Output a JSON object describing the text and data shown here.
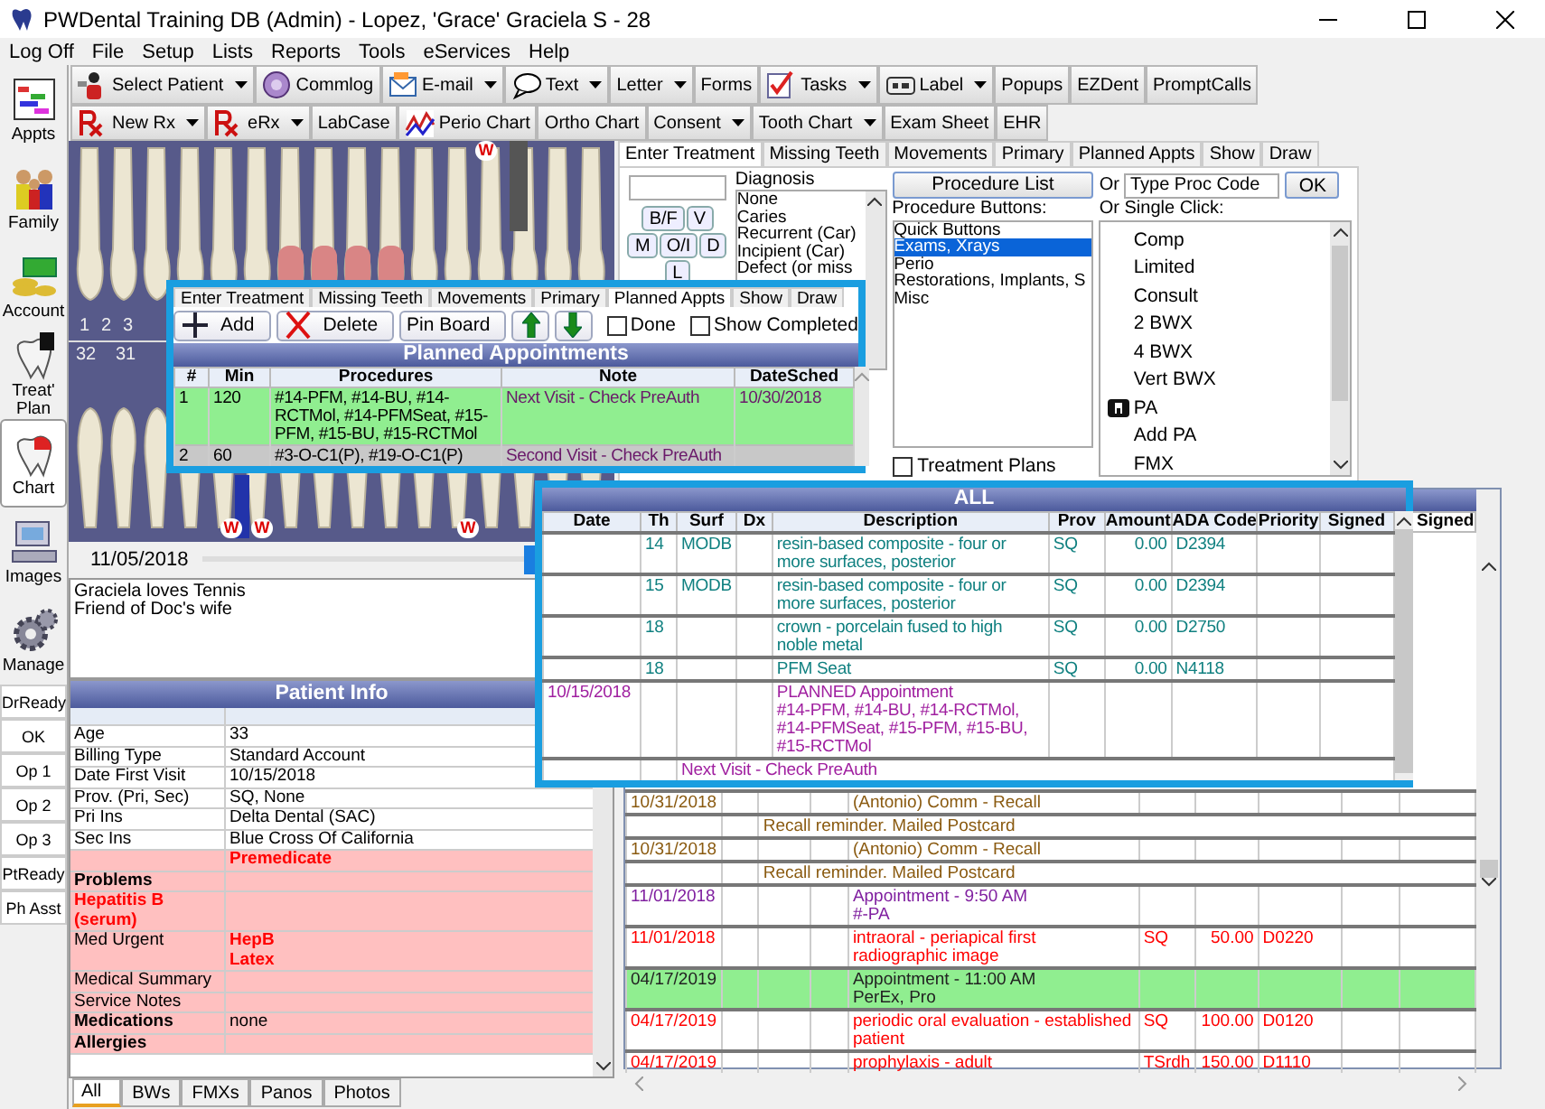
{
  "window": {
    "title": "PWDental Training DB (Admin) - Lopez, 'Grace' Graciela S - 28"
  },
  "menu": [
    "Log Off",
    "File",
    "Setup",
    "Lists",
    "Reports",
    "Tools",
    "eServices",
    "Help"
  ],
  "modules": [
    {
      "label": "Appts",
      "selected": false
    },
    {
      "label": "Family",
      "selected": false
    },
    {
      "label": "Account",
      "selected": false
    },
    {
      "label": "Treat' Plan",
      "selected": false
    },
    {
      "label": "Chart",
      "selected": true
    },
    {
      "label": "Images",
      "selected": false
    },
    {
      "label": "Manage",
      "selected": false
    }
  ],
  "status_buttons": [
    "DrReady",
    "OK",
    "Op 1",
    "Op 2",
    "Op 3",
    "PtReady",
    "Ph Asst"
  ],
  "toolbar_1": [
    {
      "label": "Select Patient",
      "dropdown": true
    },
    {
      "label": "Commlog",
      "dropdown": false
    },
    {
      "label": "E-mail",
      "dropdown": true
    },
    {
      "label": "Text",
      "dropdown": true
    },
    {
      "label": "Letter",
      "dropdown": true
    },
    {
      "label": "Forms",
      "dropdown": false
    },
    {
      "label": "Tasks",
      "dropdown": true
    },
    {
      "label": "Label",
      "dropdown": true
    },
    {
      "label": "Popups",
      "dropdown": false
    },
    {
      "label": "EZDent",
      "dropdown": false
    },
    {
      "label": "PromptCalls",
      "dropdown": false
    }
  ],
  "toolbar_2": [
    {
      "label": "New Rx",
      "dropdown": true
    },
    {
      "label": "eRx",
      "dropdown": true
    },
    {
      "label": "LabCase",
      "dropdown": false
    },
    {
      "label": "Perio Chart",
      "dropdown": false
    },
    {
      "label": "Ortho Chart",
      "dropdown": false
    },
    {
      "label": "Consent",
      "dropdown": true
    },
    {
      "label": "Tooth Chart",
      "dropdown": true
    },
    {
      "label": "Exam Sheet",
      "dropdown": false
    },
    {
      "label": "EHR",
      "dropdown": false
    }
  ],
  "tooth_chart": {
    "upper_numbers": [
      "1",
      "2",
      "3"
    ],
    "lower_numbers": [
      "32",
      "31"
    ],
    "marks": [
      "W",
      "W",
      "W",
      "W"
    ]
  },
  "date_slider": {
    "date": "11/05/2018",
    "level": 0.97
  },
  "patient_note": "Graciela loves Tennis\nFriend of Doc's wife",
  "patient_info": {
    "title": "Patient Info",
    "rows": [
      {
        "label": "Age",
        "value": "33",
        "highlighted": false,
        "label_bold": false,
        "label_red": false,
        "value_red": false
      },
      {
        "label": "Billing Type",
        "value": "Standard Account",
        "highlighted": false,
        "label_bold": false,
        "label_red": false,
        "value_red": false
      },
      {
        "label": "Date First Visit",
        "value": "10/15/2018",
        "highlighted": false,
        "label_bold": false,
        "label_red": false,
        "value_red": false
      },
      {
        "label": "Prov. (Pri, Sec)",
        "value": "SQ, None",
        "highlighted": false,
        "label_bold": false,
        "label_red": false,
        "value_red": false
      },
      {
        "label": "Pri Ins",
        "value": "Delta Dental (SAC)",
        "highlighted": false,
        "label_bold": false,
        "label_red": false,
        "value_red": false
      },
      {
        "label": "Sec Ins",
        "value": "Blue Cross Of California",
        "highlighted": false,
        "label_bold": false,
        "label_red": false,
        "value_red": false
      },
      {
        "label": "",
        "value": "Premedicate",
        "highlighted": true,
        "label_bold": false,
        "label_red": false,
        "value_red": true
      },
      {
        "label": "Problems",
        "value": "",
        "highlighted": true,
        "label_bold": true,
        "label_red": false,
        "value_red": false
      },
      {
        "label": "Hepatitis B (serum)",
        "value": "",
        "highlighted": true,
        "label_bold": true,
        "label_red": true,
        "value_red": false
      },
      {
        "label": "Med Urgent",
        "value": "HepB\nLatex",
        "highlighted": true,
        "label_bold": false,
        "label_red": false,
        "value_red": true
      },
      {
        "label": "Medical Summary",
        "value": "",
        "highlighted": true,
        "label_bold": false,
        "label_red": false,
        "value_red": false
      },
      {
        "label": "Service Notes",
        "value": "",
        "highlighted": true,
        "label_bold": false,
        "label_red": false,
        "value_red": false
      },
      {
        "label": "Medications",
        "value": "none",
        "highlighted": true,
        "label_bold": true,
        "label_red": false,
        "value_red": false
      },
      {
        "label": "Allergies",
        "value": "",
        "highlighted": true,
        "label_bold": true,
        "label_red": false,
        "value_red": false
      }
    ]
  },
  "image_tabs": [
    {
      "label": "All",
      "selected": true
    },
    {
      "label": "BWs",
      "selected": false
    },
    {
      "label": "FMXs",
      "selected": false
    },
    {
      "label": "Panos",
      "selected": false
    },
    {
      "label": "Photos",
      "selected": false
    }
  ],
  "chart_tabs": [
    {
      "label": "Enter Treatment",
      "selected": true
    },
    {
      "label": "Missing Teeth",
      "selected": false
    },
    {
      "label": "Movements",
      "selected": false
    },
    {
      "label": "Primary",
      "selected": false
    },
    {
      "label": "Planned Appts",
      "selected": false
    },
    {
      "label": "Show",
      "selected": false
    },
    {
      "label": "Draw",
      "selected": false
    }
  ],
  "enter_treatment": {
    "surface_buttons": [
      "B/F",
      "V",
      "M",
      "O/I",
      "D",
      "L"
    ],
    "diagnosis_label": "Diagnosis",
    "diagnosis_items": [
      "None",
      "Caries",
      "Recurrent (Car)",
      "Incipient (Car)",
      "Defect (or miss"
    ],
    "procedure_list_button": "Procedure List",
    "procedure_buttons_label": "Procedure Buttons:",
    "procedure_categories": [
      {
        "label": "Quick Buttons",
        "selected": false
      },
      {
        "label": "Exams, Xrays",
        "selected": true
      },
      {
        "label": "Perio",
        "selected": false
      },
      {
        "label": "Restorations, Implants, S",
        "selected": false
      },
      {
        "label": "Misc",
        "selected": false
      }
    ],
    "treatment_plans": {
      "label": "Treatment Plans",
      "checked": false
    },
    "or_label": "Or",
    "proc_code_value": "Type Proc Code",
    "ok_button": "OK",
    "single_click_label": "Or Single Click:",
    "single_click_items": [
      {
        "label": "Comp",
        "icon": false
      },
      {
        "label": "Limited",
        "icon": false
      },
      {
        "label": "Consult",
        "icon": false
      },
      {
        "label": "2 BWX",
        "icon": false
      },
      {
        "label": "4 BWX",
        "icon": false
      },
      {
        "label": "Vert BWX",
        "icon": false
      },
      {
        "label": "PA",
        "icon": true
      },
      {
        "label": "Add PA",
        "icon": false
      },
      {
        "label": "FMX",
        "icon": false
      }
    ]
  },
  "progress_notes": {
    "columns": [
      "",
      "",
      "",
      "",
      "",
      "",
      "",
      "",
      "",
      "Signed"
    ],
    "rows": [
      {
        "kind": "commlog",
        "date": "10/31/2018",
        "description": "(Antonio) Comm - Recall",
        "prov": "",
        "amount": "",
        "code": ""
      },
      {
        "kind": "note",
        "text": "Recall reminder.  Mailed Postcard"
      },
      {
        "kind": "commlog",
        "date": "10/31/2018",
        "description": "(Antonio) Comm - Recall",
        "prov": "",
        "amount": "",
        "code": ""
      },
      {
        "kind": "note",
        "text": "Recall reminder.  Mailed Postcard"
      },
      {
        "kind": "appointment",
        "date": "11/01/2018",
        "description": "Appointment - 9:50 AM\n#-PA",
        "prov": "",
        "amount": "",
        "code": ""
      },
      {
        "kind": "completed",
        "date": "11/01/2018",
        "description": "intraoral - periapical first radiographic image",
        "prov": "SQ",
        "amount": "50.00",
        "code": "D0220"
      },
      {
        "kind": "appointment_done",
        "date": "04/17/2019",
        "description": "Appointment - 11:00 AM\nPerEx, Pro",
        "prov": "",
        "amount": "",
        "code": ""
      },
      {
        "kind": "completed",
        "date": "04/17/2019",
        "description": "periodic oral evaluation - established patient",
        "prov": "SQ",
        "amount": "100.00",
        "code": "D0120"
      },
      {
        "kind": "completed",
        "date": "04/17/2019",
        "description": "prophylaxis - adult",
        "prov": "TSrdh",
        "amount": "150.00",
        "code": "D1110"
      }
    ]
  },
  "planned_appointments": {
    "tabs": [
      {
        "label": "Enter Treatment",
        "selected": false
      },
      {
        "label": "Missing Teeth",
        "selected": false
      },
      {
        "label": "Movements",
        "selected": false
      },
      {
        "label": "Primary",
        "selected": false
      },
      {
        "label": "Planned Appts",
        "selected": true
      },
      {
        "label": "Show",
        "selected": false
      },
      {
        "label": "Draw",
        "selected": false
      }
    ],
    "buttons": [
      "Add",
      "Delete",
      "Pin Board"
    ],
    "done": {
      "label": "Done",
      "checked": false
    },
    "show_completed": {
      "label": "Show Completed",
      "checked": false
    },
    "title": "Planned Appointments",
    "columns": [
      "#",
      "Min",
      "Procedures",
      "Note",
      "DateSched"
    ],
    "rows": [
      {
        "number": "1",
        "min": "120",
        "procedures": "#14-PFM, #14-BU, #14-RCTMol, #14-PFMSeat, #15-PFM, #15-BU, #15-RCTMol",
        "note": "Next Visit - Check PreAuth",
        "date": "10/30/2018",
        "color": "#90ee90"
      },
      {
        "number": "2",
        "min": "60",
        "procedures": "#3-O-C1(P), #19-O-C1(P)",
        "note": "Second Visit - Check PreAuth",
        "date": "",
        "color": "#c8c8c8"
      }
    ]
  },
  "all_procedures": {
    "title": "ALL",
    "columns": [
      "Date",
      "Th",
      "Surf",
      "Dx",
      "Description",
      "Prov",
      "Amount",
      "ADA Code",
      "Priority",
      "Signed"
    ],
    "rows": [
      {
        "kind": "procedure",
        "cells": [
          "",
          "14",
          "MODB",
          "",
          "resin-based composite - four or more surfaces, posterior",
          "SQ",
          "0.00",
          "D2394",
          "",
          ""
        ]
      },
      {
        "kind": "procedure",
        "cells": [
          "",
          "15",
          "MODB",
          "",
          "resin-based composite - four or more surfaces, posterior",
          "SQ",
          "0.00",
          "D2394",
          "",
          ""
        ]
      },
      {
        "kind": "procedure",
        "cells": [
          "",
          "18",
          "",
          "",
          "crown - porcelain fused to high noble metal",
          "SQ",
          "0.00",
          "D2750",
          "",
          ""
        ]
      },
      {
        "kind": "procedure",
        "cells": [
          "",
          "18",
          "",
          "",
          "PFM Seat",
          "SQ",
          "0.00",
          "N4118",
          "",
          ""
        ]
      },
      {
        "kind": "planned",
        "cells": [
          "10/15/2018",
          "",
          "",
          "",
          "PLANNED Appointment\n#14-PFM, #14-BU, #14-RCTMol, #14-PFMSeat, #15-PFM, #15-BU, #15-RCTMol",
          "",
          "",
          "",
          "",
          ""
        ]
      },
      {
        "kind": "note",
        "note": "Next Visit - Check PreAuth"
      }
    ]
  }
}
